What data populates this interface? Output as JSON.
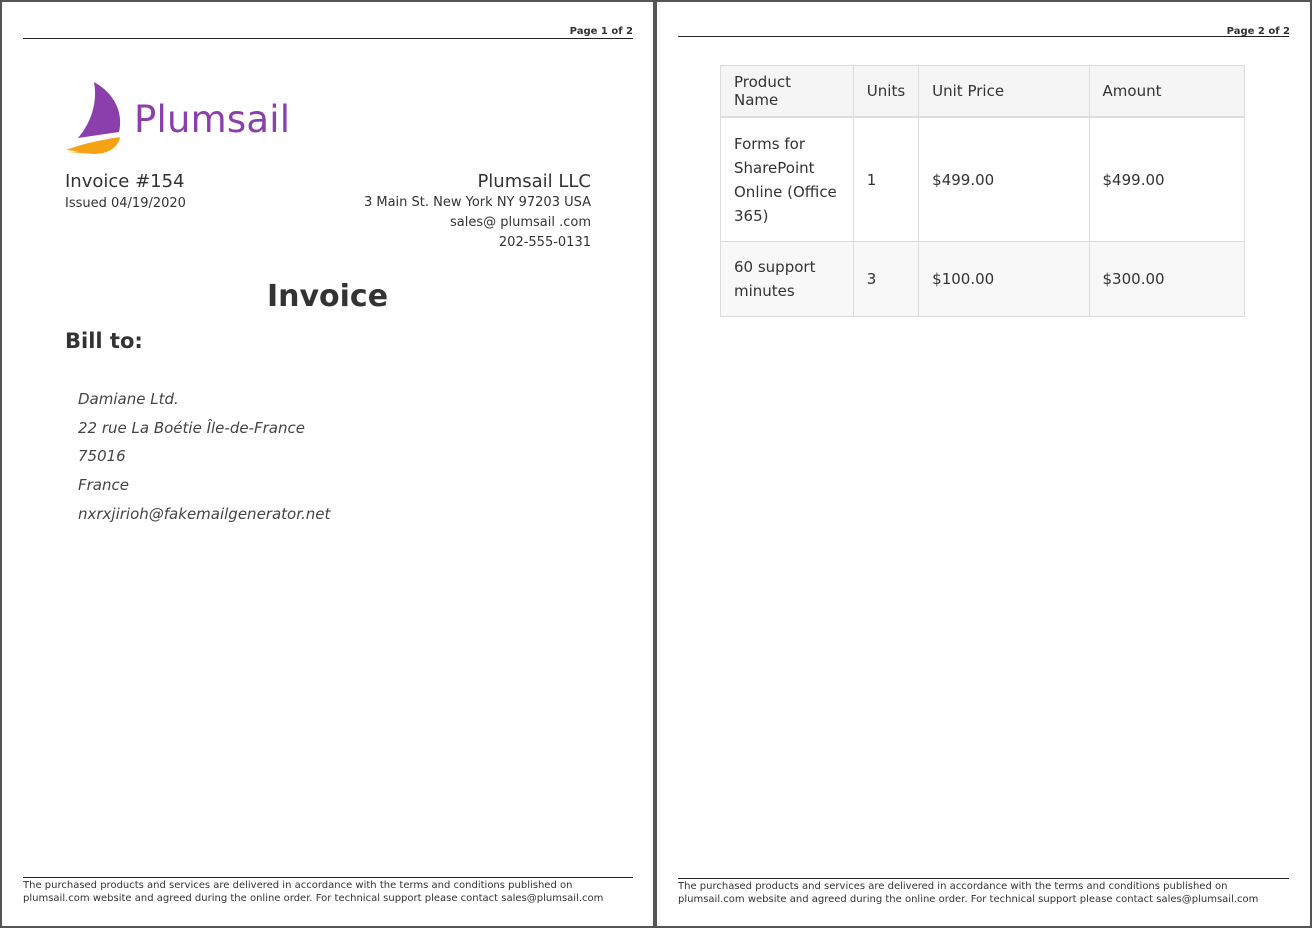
{
  "pages": [
    {
      "page_label": "Page 1 of 2",
      "logo_text": "Plumsail",
      "invoice_number": "Invoice #154",
      "issued": "Issued 04/19/2020",
      "company": {
        "name": "Plumsail LLC",
        "address": "3 Main St. New York NY 97203 USA",
        "email": "sales@ plumsail .com",
        "phone": "202-555-0131"
      },
      "title": "Invoice",
      "bill_to_label": "Bill to:",
      "bill_to": [
        "Damiane Ltd.",
        "22 rue La Boétie Île-de-France",
        "75016",
        "France",
        "nxrxjirioh@fakemailgenerator.net"
      ],
      "footer_line1": "The purchased products and services are delivered in accordance with the terms and conditions published on",
      "footer_line2": "plumsail.com website and agreed during the online order. For technical support please contact sales@plumsail.com"
    },
    {
      "page_label": "Page 2 of 2",
      "table": {
        "headers": [
          "Product Name",
          "Units",
          "Unit Price",
          "Amount"
        ],
        "rows": [
          [
            "Forms for SharePoint Online (Office 365)",
            "1",
            "$499.00",
            "$499.00"
          ],
          [
            "60 support minutes",
            "3",
            "$100.00",
            "$300.00"
          ]
        ]
      },
      "footer_line1": "The purchased products and services are delivered in accordance with the terms and conditions published on",
      "footer_line2": "plumsail.com website and agreed during the online order. For technical support please contact sales@plumsail.com"
    }
  ],
  "colors": {
    "brand_purple": "#8b3fad",
    "brand_orange": "#f5a214"
  }
}
